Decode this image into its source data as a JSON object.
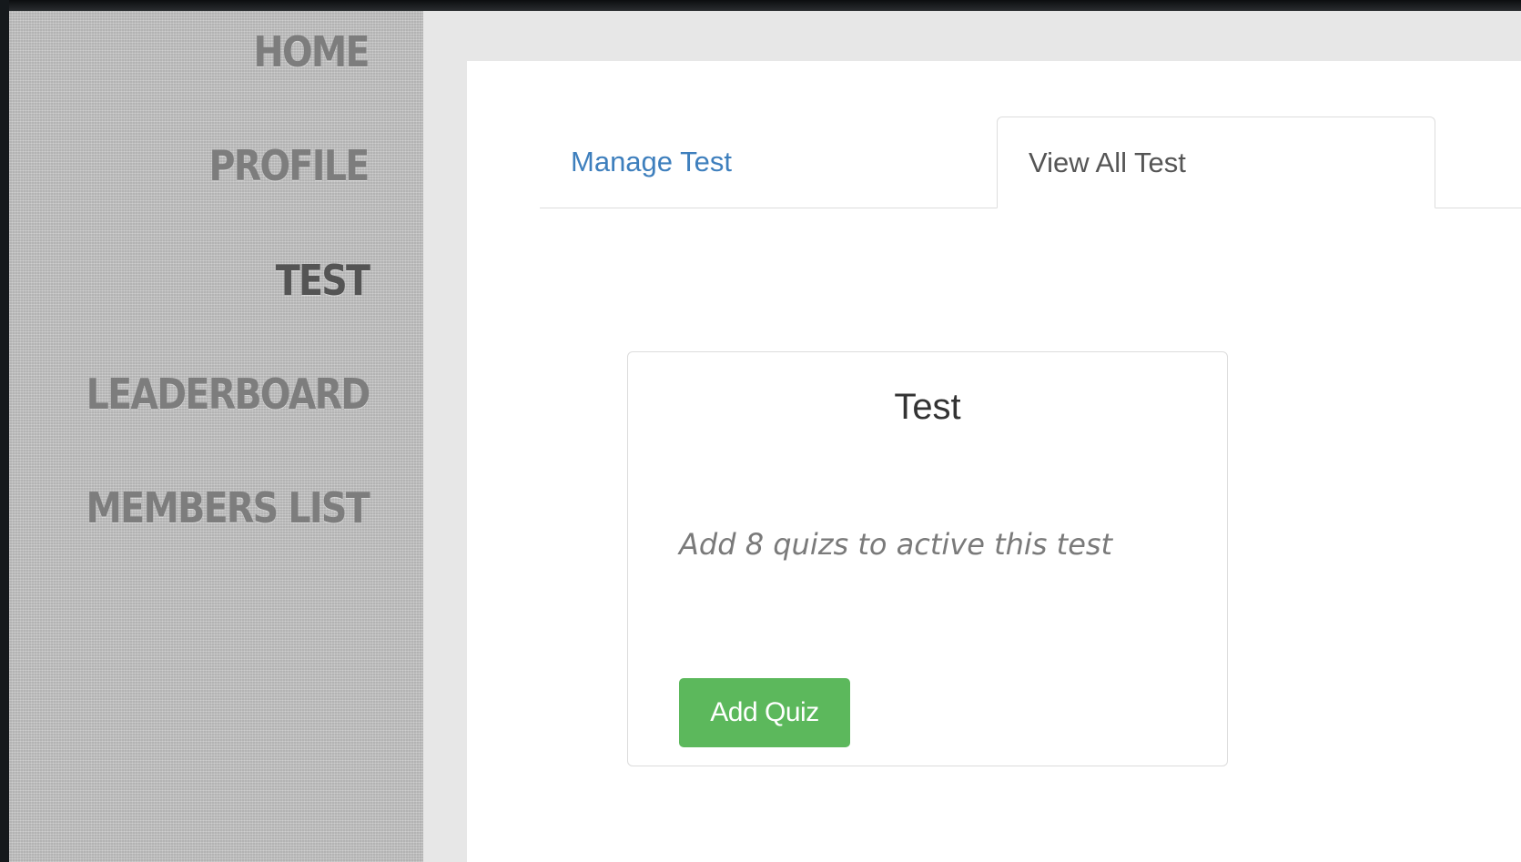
{
  "sidebar": {
    "items": [
      {
        "label": "HOME",
        "active": false
      },
      {
        "label": "PROFILE",
        "active": false
      },
      {
        "label": "TEST",
        "active": true
      },
      {
        "label": "LEADERBOARD",
        "active": false
      },
      {
        "label": "MEMBERS LIST",
        "active": false
      }
    ]
  },
  "tabs": [
    {
      "label": "Manage Test",
      "active": false
    },
    {
      "label": "View All Test",
      "active": true
    }
  ],
  "card": {
    "title": "Test",
    "description": "Add 8 quizs to active this test",
    "button_label": "Add Quiz"
  },
  "colors": {
    "link": "#3e7fbd",
    "button": "#5cb85c",
    "nav_text": "#7d7d7d",
    "nav_active_text": "#545454"
  }
}
